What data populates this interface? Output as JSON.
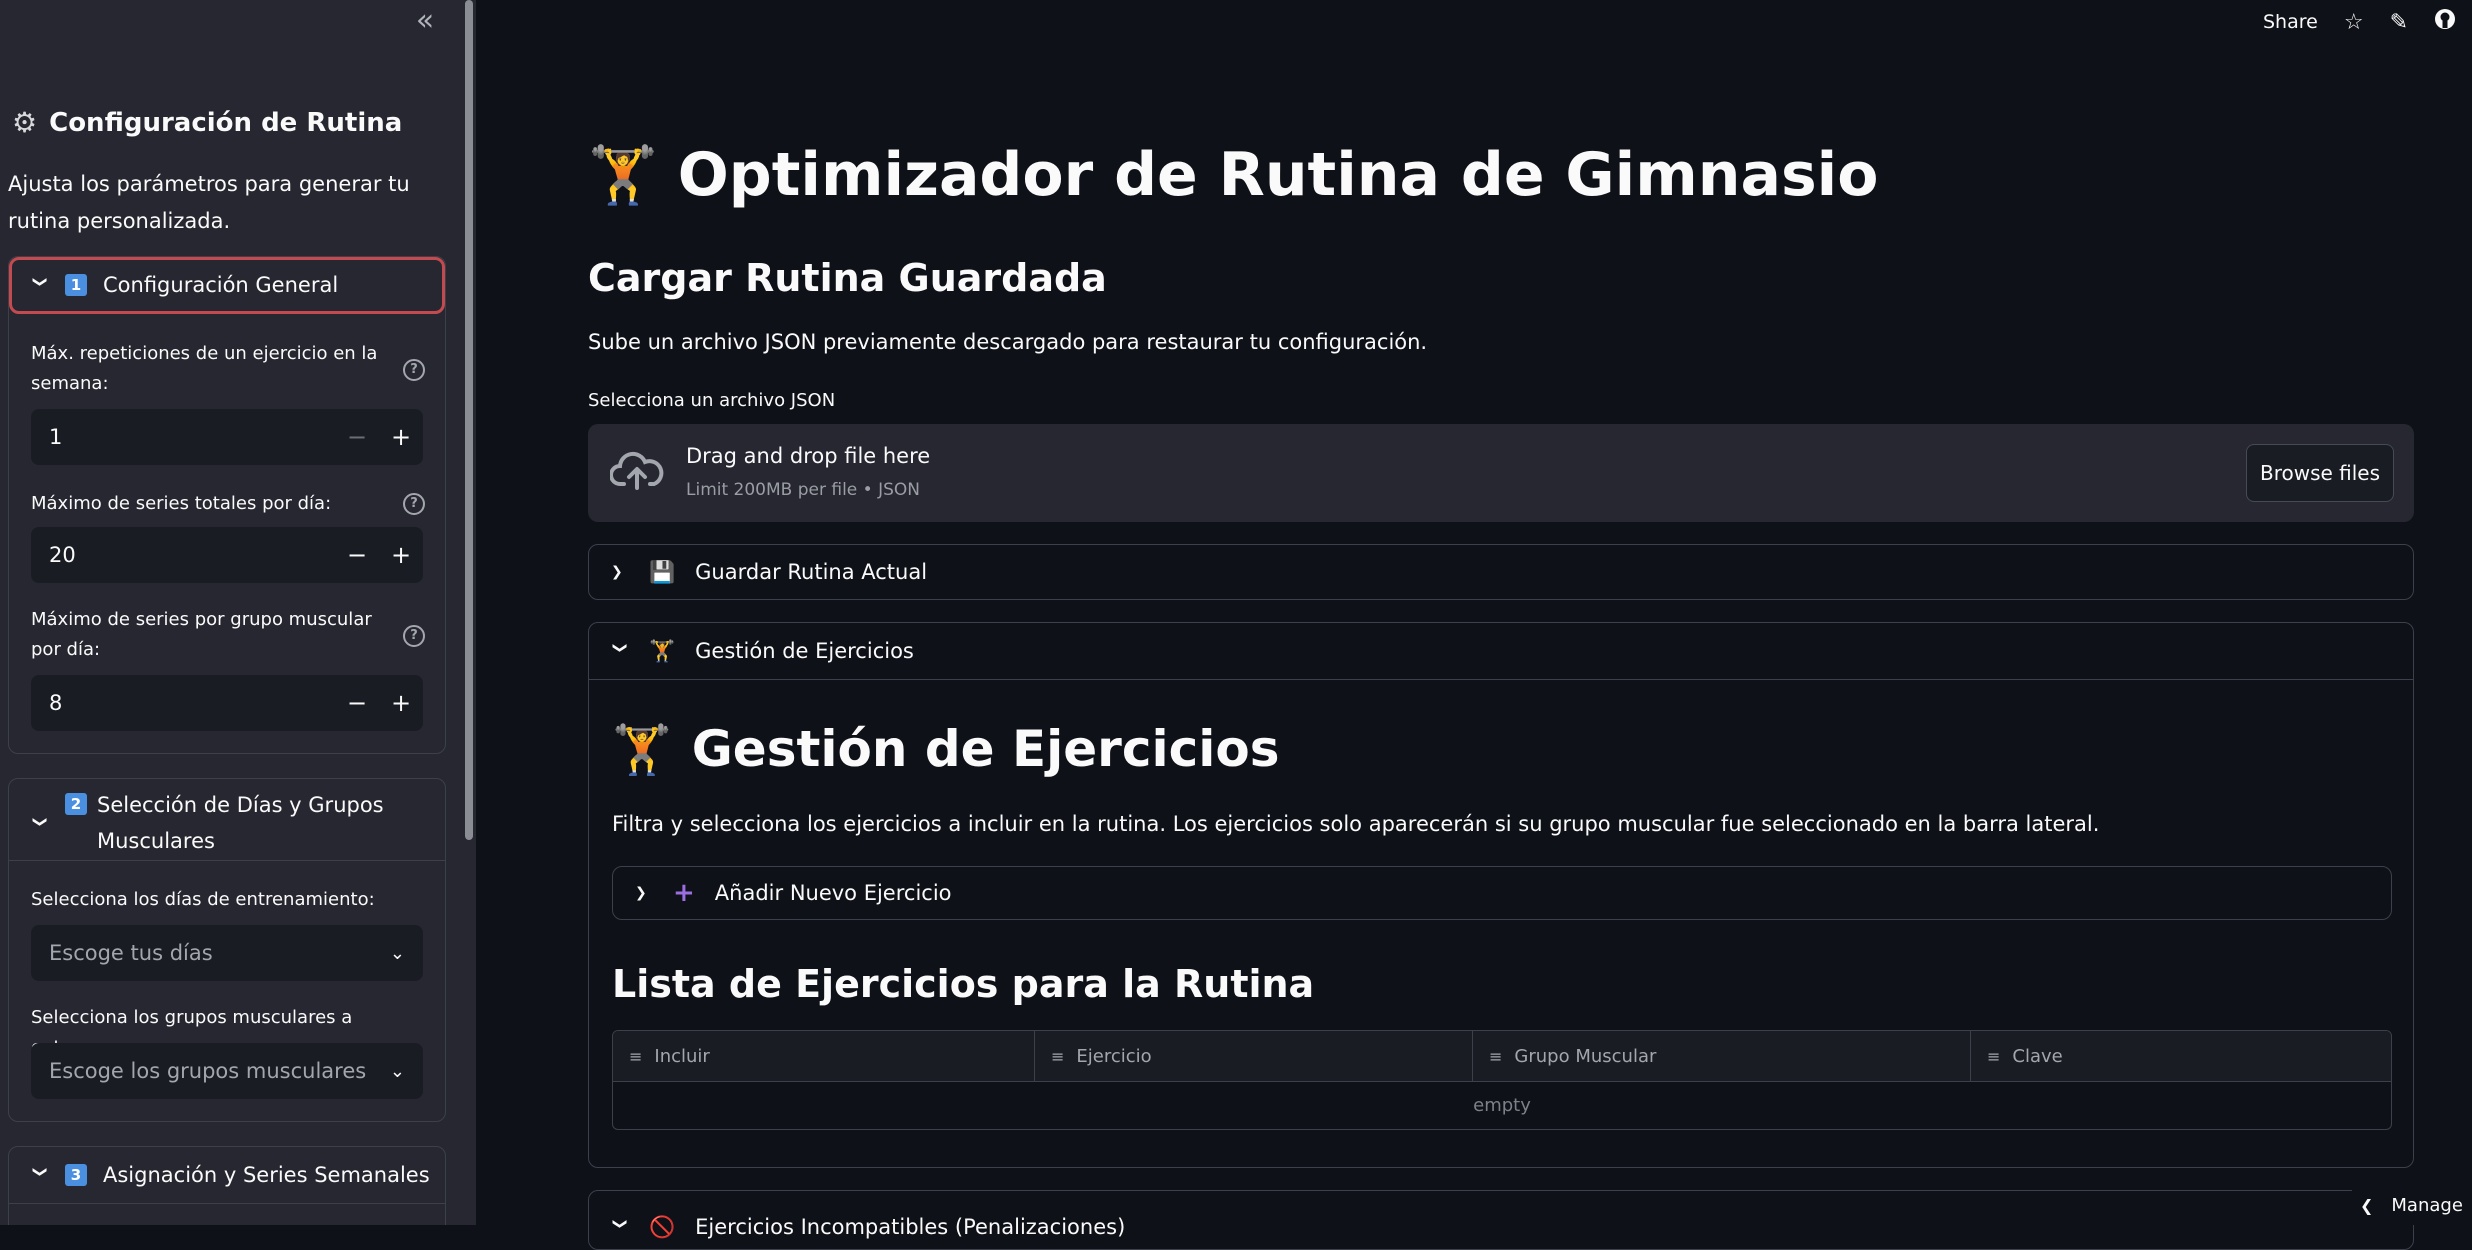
{
  "sidebar": {
    "collapse_icon": "«",
    "title": "Configuración de Rutina",
    "description": "Ajusta los parámetros para generar tu rutina personalizada.",
    "sections": [
      {
        "number": "1",
        "label": "Configuración General",
        "fields": [
          {
            "label": "Máx. repeticiones de un ejercicio en la semana:",
            "value": "1"
          },
          {
            "label": "Máximo de series totales por día:",
            "value": "20"
          },
          {
            "label": "Máximo de series por grupo muscular por día:",
            "value": "8"
          }
        ]
      },
      {
        "number": "2",
        "label": "Selección de Días y Grupos Musculares",
        "fields": [
          {
            "label": "Selecciona los días de entrenamiento:",
            "placeholder": "Escoge tus días"
          },
          {
            "label": "Selecciona los grupos musculares a entrenar:",
            "placeholder": "Escoge los grupos musculares"
          }
        ]
      },
      {
        "number": "3",
        "label": "Asignación y Series Semanales"
      }
    ]
  },
  "topbar": {
    "share": "Share",
    "star_icon": "☆",
    "edit_icon": "✎",
    "github_icon": "●"
  },
  "main": {
    "title": "Optimizador de Rutina de Gimnasio",
    "load_heading": "Cargar Rutina Guardada",
    "load_desc": "Sube un archivo JSON previamente descargado para restaurar tu configuración.",
    "upload_label": "Selecciona un archivo JSON",
    "drag_text": "Drag and drop file here",
    "limit_text": "Limit 200MB per file • JSON",
    "browse": "Browse files",
    "save_expander": "Guardar Rutina Actual",
    "manage_expander": "Gestión de Ejercicios",
    "manage_title": "Gestión de Ejercicios",
    "manage_desc": "Filtra y selecciona los ejercicios a incluir en la rutina. Los ejercicios solo aparecerán si su grupo muscular fue seleccionado en la barra lateral.",
    "add_expander": "Añadir Nuevo Ejercicio",
    "list_heading": "Lista de Ejercicios para la Rutina",
    "columns": [
      "Incluir",
      "Ejercicio",
      "Grupo Muscular",
      "Clave"
    ],
    "empty": "empty",
    "incompat_expander": "Ejercicios Incompatibles (Penalizaciones)",
    "manage_app": "Manage"
  }
}
